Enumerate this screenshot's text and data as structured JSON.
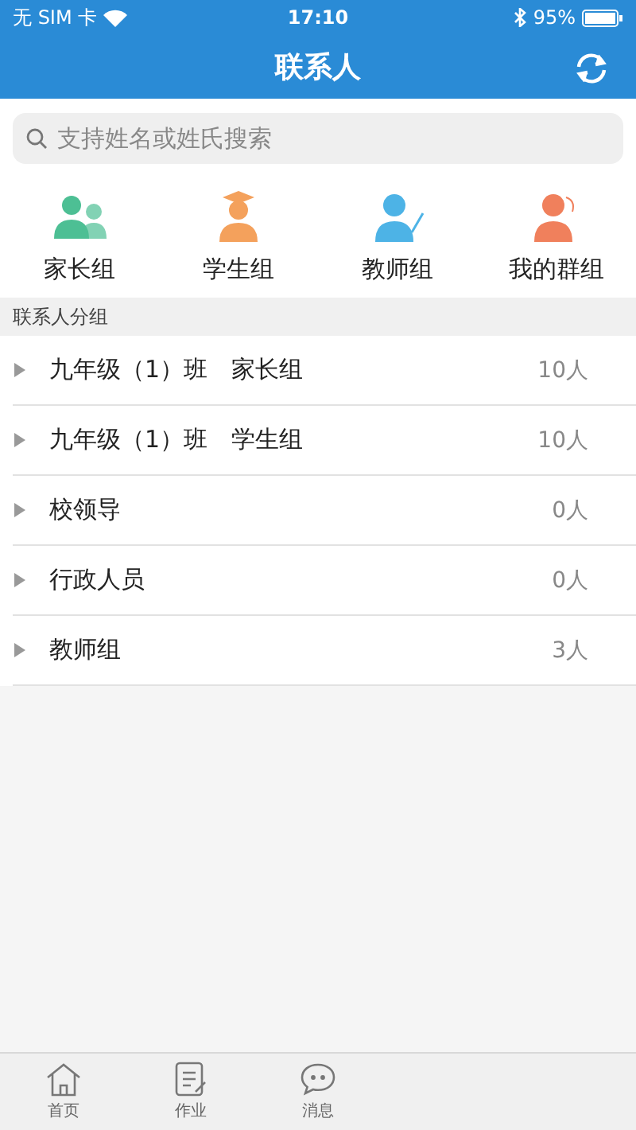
{
  "status_bar": {
    "carrier": "无 SIM 卡",
    "time": "17:10",
    "battery": "95%"
  },
  "nav_bar": {
    "title": "联系人"
  },
  "search": {
    "placeholder": "支持姓名或姓氏搜索"
  },
  "groups": [
    {
      "kind": "parents",
      "label": "家长组",
      "color": "#4dbf94"
    },
    {
      "kind": "students",
      "label": "学生组",
      "color": "#f4a15c"
    },
    {
      "kind": "teachers",
      "label": "教师组",
      "color": "#4db3e6"
    },
    {
      "kind": "mine",
      "label": "我的群组",
      "color": "#f0805c"
    }
  ],
  "section_header": "联系人分组",
  "contact_groups": [
    {
      "name": "九年级（1）班　家长组",
      "count": "10人",
      "expanded": false
    },
    {
      "name": "九年级（1）班　学生组",
      "count": "10人",
      "expanded": false
    },
    {
      "name": "校领导",
      "count": "0人",
      "expanded": false
    },
    {
      "name": "行政人员",
      "count": "0人",
      "expanded": false
    },
    {
      "name": "教师组",
      "count": "3人",
      "expanded": false
    }
  ],
  "tab_bar": [
    {
      "kind": "home",
      "label": "首页"
    },
    {
      "kind": "homework",
      "label": "作业"
    },
    {
      "kind": "messages",
      "label": "消息"
    }
  ]
}
